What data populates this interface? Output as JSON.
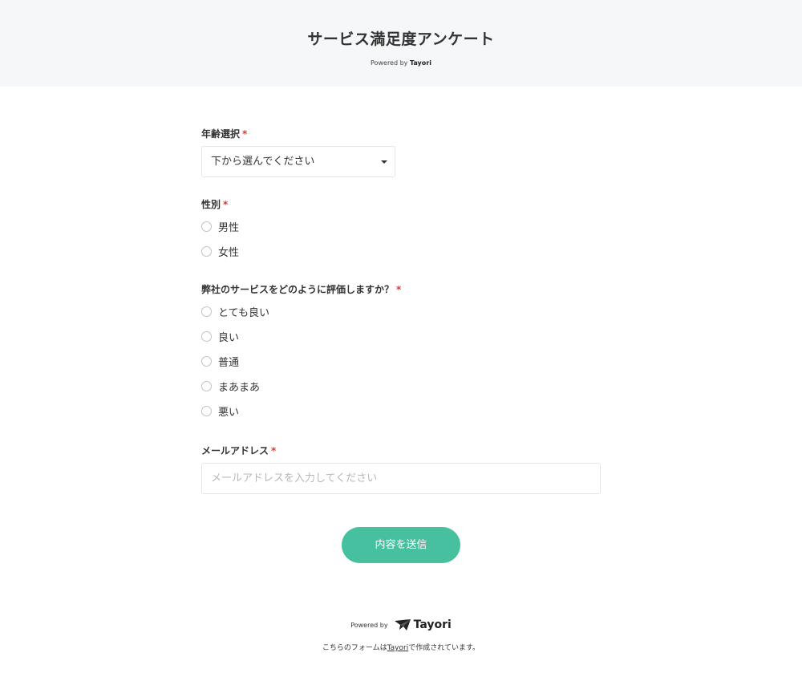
{
  "header": {
    "title": "サービス満足度アンケート",
    "powered_prefix": "Powered by ",
    "powered_brand": "Tayori"
  },
  "form": {
    "age": {
      "label": "年齢選択",
      "required": "*",
      "selected": "下から選んでください"
    },
    "gender": {
      "label": "性別",
      "required": "*",
      "options": [
        "男性",
        "女性"
      ]
    },
    "rating": {
      "label": "弊社のサービスをどのように評価しますか？",
      "required": "*",
      "options": [
        "とても良い",
        "良い",
        "普通",
        "まあまあ",
        "悪い"
      ]
    },
    "email": {
      "label": "メールアドレス",
      "required": "*",
      "placeholder": "メールアドレスを入力してください",
      "value": ""
    },
    "submit_label": "内容を送信"
  },
  "footer": {
    "powered_label": "Powered by",
    "brand": "Tayori",
    "note_prefix": "こちらのフォームは",
    "note_link": "Tayori",
    "note_suffix": "で作成されています。"
  },
  "colors": {
    "accent": "#46c09e",
    "required": "#e0392f",
    "header_bg": "#f6f7f8"
  },
  "icons": {
    "select_caret": "caret-down-icon",
    "brand_logo": "tayori-logo-icon"
  }
}
